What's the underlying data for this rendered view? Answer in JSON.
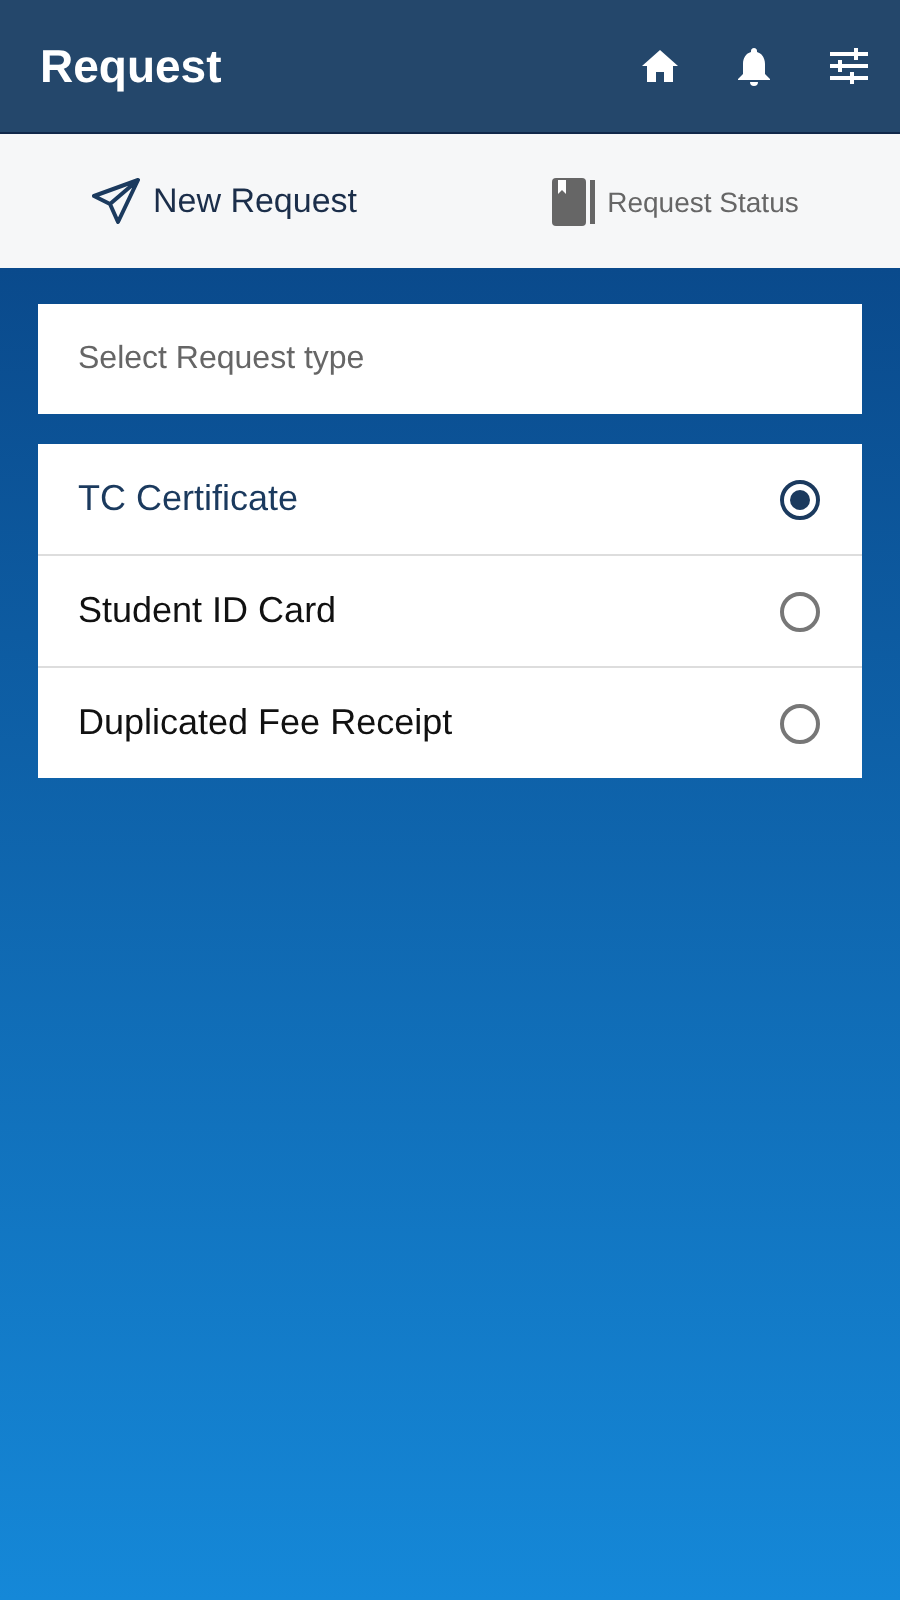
{
  "app_bar": {
    "title": "Request"
  },
  "tabs": [
    {
      "label": "New Request",
      "selected": true,
      "kind": "send"
    },
    {
      "label": "Request Status",
      "selected": false,
      "kind": "book"
    }
  ],
  "request_type": {
    "placeholder": "Select Request type"
  },
  "options": [
    {
      "label": "TC Certificate",
      "selected": true
    },
    {
      "label": "Student ID Card",
      "selected": false
    },
    {
      "label": "Duplicated Fee Receipt",
      "selected": false
    }
  ]
}
